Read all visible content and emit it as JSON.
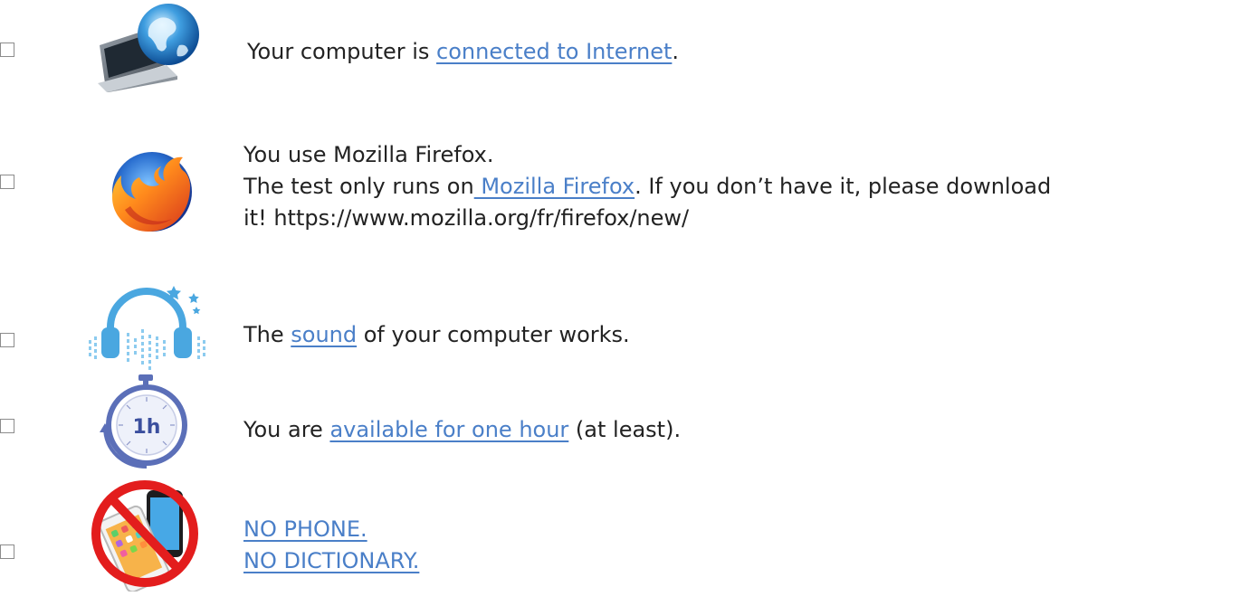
{
  "checklist": [
    {
      "icon": "laptop-globe-icon",
      "checked": false,
      "before": "Your computer is ",
      "link": "connected to Internet",
      "after": "."
    },
    {
      "icon": "firefox-logo-icon",
      "checked": false,
      "line1": "You use Mozilla Firefox.",
      "line2_before": "The test only runs on",
      "line2_link": " Mozilla Firefox",
      "line2_after": ". If you don’t have it, please download",
      "line3": "it! https://www.mozilla.org/fr/firefox/new/"
    },
    {
      "icon": "headphones-icon",
      "checked": false,
      "before": "The ",
      "link": "sound",
      "after": " of your computer works."
    },
    {
      "icon": "stopwatch-icon",
      "checked": false,
      "icon_label": "1h",
      "before": "You are ",
      "link": "available for one hour",
      "after": " (at least)."
    },
    {
      "icon": "no-phone-icon",
      "checked": false,
      "line1_link": "NO PHONE.",
      "line2_link": "NO DICTIONARY."
    }
  ],
  "colors": {
    "link": "#4a7fc8",
    "text": "#222222",
    "checkbox_border": "#8c8c8c"
  }
}
